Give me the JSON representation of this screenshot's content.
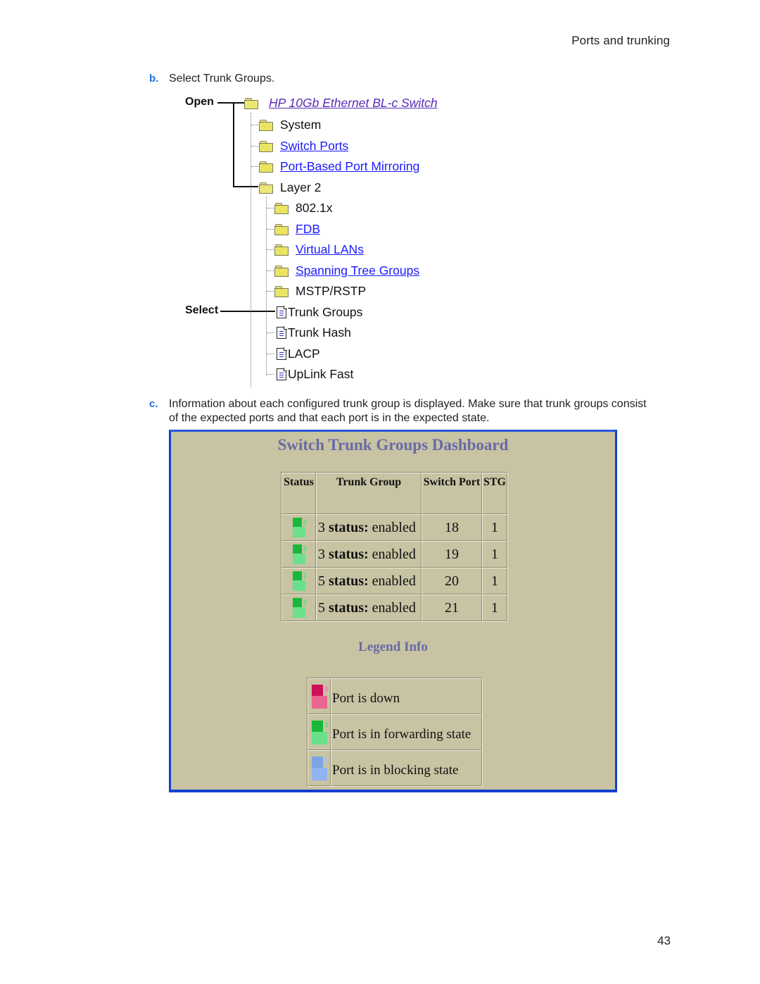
{
  "running_head": "Ports and trunking",
  "page_number": "43",
  "steps": {
    "b": {
      "letter": "b.",
      "text": "Select Trunk Groups."
    },
    "c": {
      "letter": "c.",
      "line1": "Information about each configured trunk group is displayed. Make sure that trunk groups consist",
      "line2": "of the expected ports and that each port is in the expected state."
    }
  },
  "tree": {
    "callouts": {
      "open": "Open",
      "select": "Select"
    },
    "root": {
      "label": "HP 10Gb Ethernet BL-c Switch",
      "icon": "folder-open-icon",
      "link": true
    },
    "items": [
      {
        "label": "System",
        "icon": "folder-icon",
        "link": false
      },
      {
        "label": "Switch Ports",
        "icon": "folder-icon",
        "link": true
      },
      {
        "label": "Port-Based Port Mirroring",
        "icon": "folder-icon",
        "link": true
      },
      {
        "label": "Layer 2",
        "icon": "folder-open-icon",
        "link": false
      }
    ],
    "layer2_items": [
      {
        "label": "802.1x",
        "icon": "folder-icon",
        "link": false
      },
      {
        "label": "FDB",
        "icon": "folder-icon",
        "link": true
      },
      {
        "label": "Virtual LANs",
        "icon": "folder-icon",
        "link": true
      },
      {
        "label": "Spanning Tree Groups",
        "icon": "folder-icon",
        "link": true
      },
      {
        "label": "MSTP/RSTP",
        "icon": "folder-icon",
        "link": false
      },
      {
        "label": "Trunk Groups",
        "icon": "document-icon",
        "link": false
      },
      {
        "label": "Trunk Hash",
        "icon": "document-icon",
        "link": false
      },
      {
        "label": "LACP",
        "icon": "document-icon",
        "link": false
      },
      {
        "label": "UpLink Fast",
        "icon": "document-icon",
        "link": false
      }
    ]
  },
  "dashboard": {
    "title": "Switch Trunk Groups Dashboard",
    "columns": [
      "Status",
      "Trunk Group",
      "Switch Port",
      "STG"
    ],
    "rows": [
      {
        "status": "forwarding",
        "trunk_num": "3",
        "status_label": "status:",
        "status_value": "enabled",
        "switch_port": "18",
        "stg": "1"
      },
      {
        "status": "forwarding",
        "trunk_num": "3",
        "status_label": "status:",
        "status_value": "enabled",
        "switch_port": "19",
        "stg": "1"
      },
      {
        "status": "forwarding",
        "trunk_num": "5",
        "status_label": "status:",
        "status_value": "enabled",
        "switch_port": "20",
        "stg": "1"
      },
      {
        "status": "forwarding",
        "trunk_num": "5",
        "status_label": "status:",
        "status_value": "enabled",
        "switch_port": "21",
        "stg": "1"
      }
    ],
    "legend_title": "Legend Info",
    "legend": [
      {
        "color": "red",
        "text": "Port is down"
      },
      {
        "color": "green",
        "text": "Port is in forwarding state"
      },
      {
        "color": "blue",
        "text": "Port is in blocking state"
      }
    ],
    "colors": {
      "frame": "#1340d0",
      "background": "#c7c3a3",
      "title": "#6a6aa6"
    }
  }
}
